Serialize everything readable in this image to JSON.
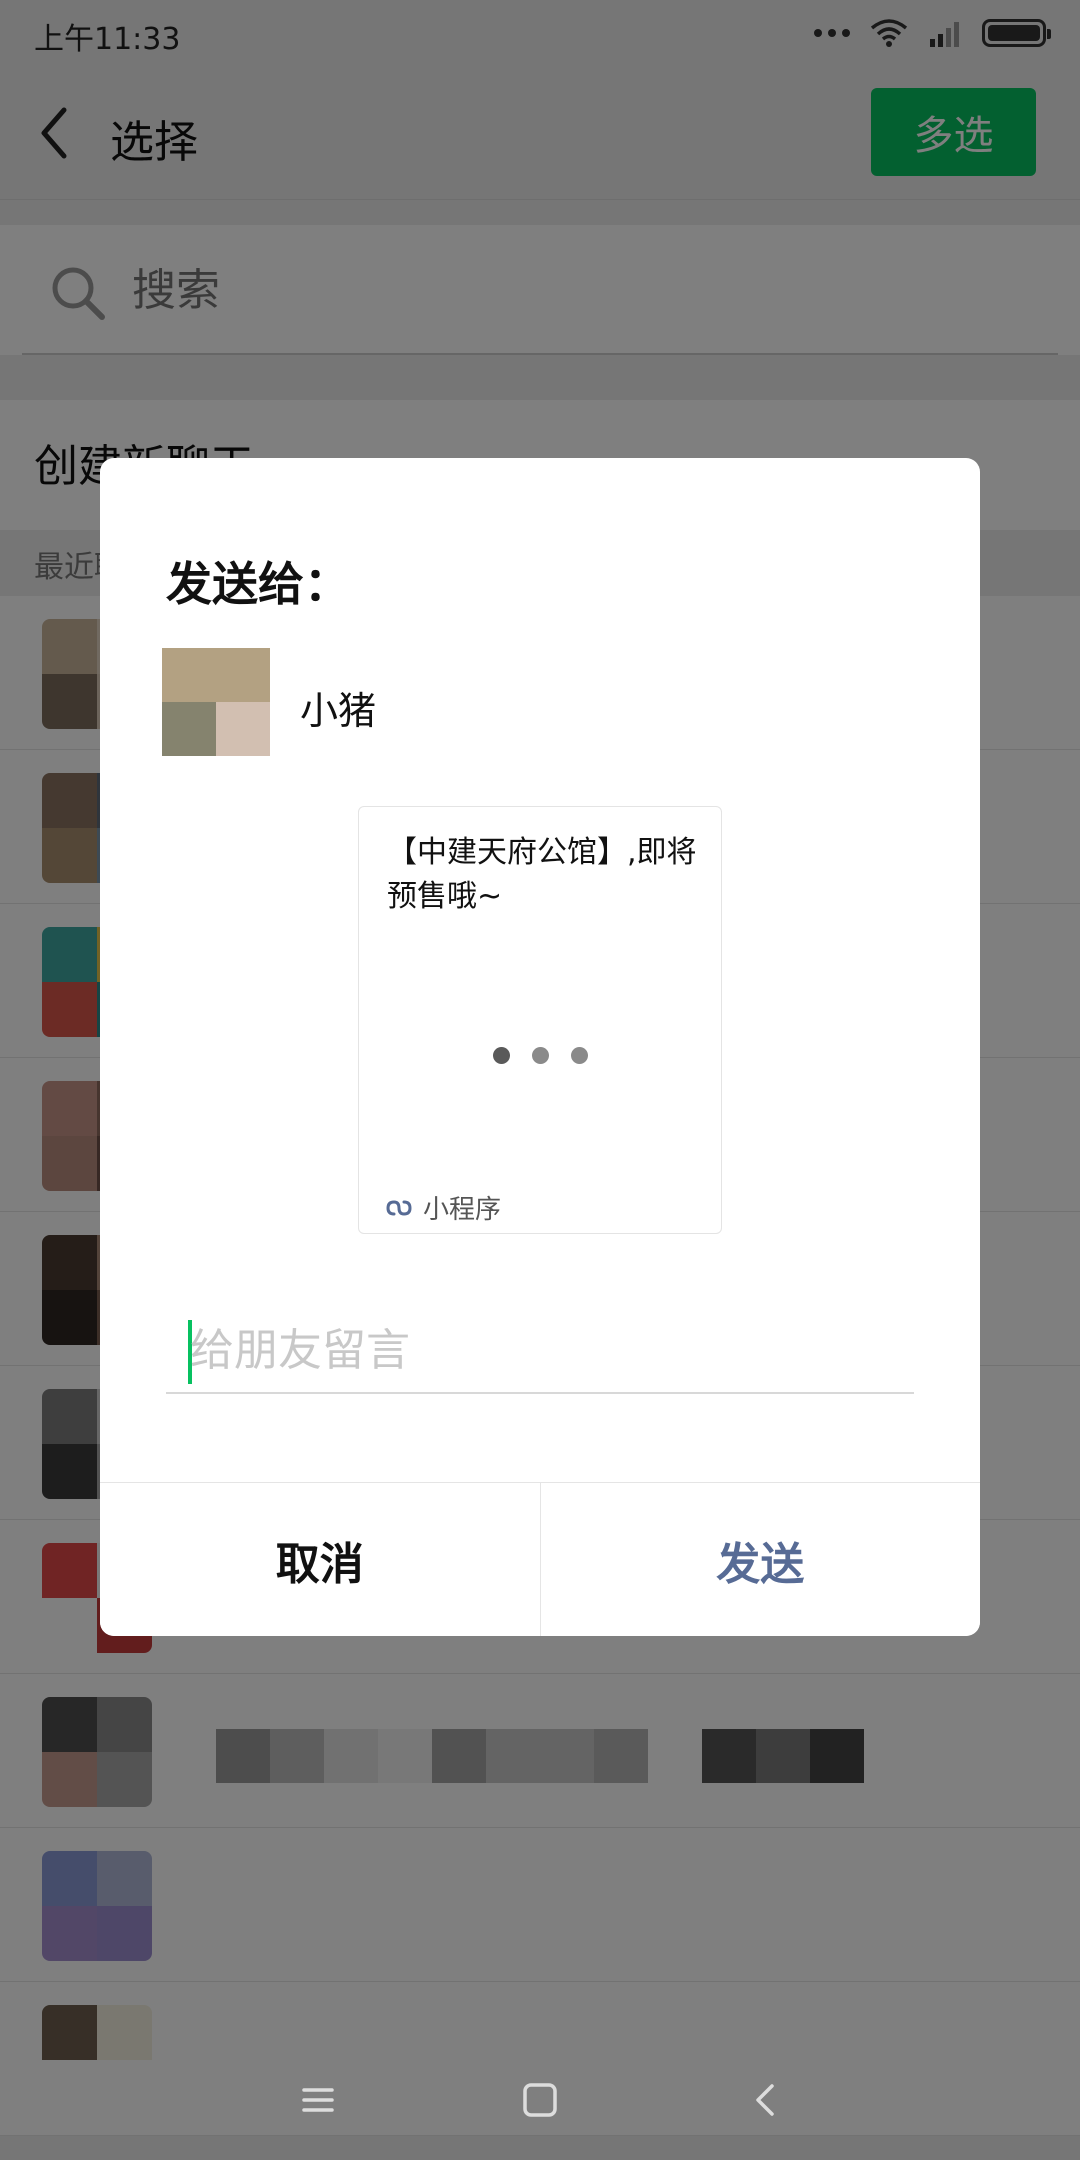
{
  "status_bar": {
    "time": "上午11:33"
  },
  "nav": {
    "title": "选择",
    "multi_select_label": "多选"
  },
  "search": {
    "placeholder": "搜索"
  },
  "create_chat": {
    "label": "创建新聊天"
  },
  "section": {
    "recent_label": "最近聊天"
  },
  "dialog": {
    "title": "发送给：",
    "recipient": {
      "name": "小猪"
    },
    "card": {
      "title": "【中建天府公馆】,即将预售哦~",
      "footer_label": "小程序"
    },
    "message": {
      "placeholder": "给朋友留言"
    },
    "actions": {
      "cancel_label": "取消",
      "send_label": "发送"
    }
  },
  "colors": {
    "accent_green": "#07c160",
    "link_blue": "#576b95",
    "loading_dot_dark": "#5a5a5a",
    "loading_dot_light": "#b5b5b5",
    "mp_icon": "#576b95"
  },
  "icons": {
    "back": "chevron-left-icon",
    "search": "magnifier-icon",
    "miniprogram": "link-icon",
    "menu": "hamburger-icon",
    "home": "square-icon",
    "sys_back": "chevron-left-icon"
  }
}
